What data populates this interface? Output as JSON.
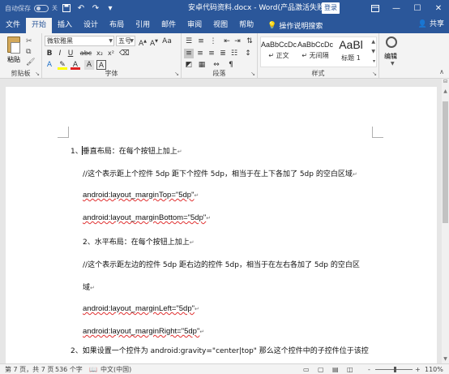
{
  "titlebar": {
    "autosave_label": "自动保存",
    "autosave_state": "关",
    "title": "安卓代码资料.docx  -  Word(产品激活失败)",
    "login": "登录",
    "icons": [
      "save-icon",
      "undo-icon",
      "redo-icon",
      "customize-icon"
    ],
    "ribbon_display_icon": "ribbon-display-icon",
    "minimize": "—",
    "restore": "☐",
    "close": "✕"
  },
  "tabs": {
    "items": [
      "文件",
      "开始",
      "插入",
      "设计",
      "布局",
      "引用",
      "邮件",
      "审阅",
      "视图",
      "帮助"
    ],
    "active": "开始",
    "tell_me": "操作说明搜索",
    "share": "共享"
  },
  "ribbon": {
    "clipboard": {
      "paste": "粘贴",
      "label": "剪贴板"
    },
    "font": {
      "name": "微软雅黑",
      "size": "五号",
      "label": "字体",
      "buttons": [
        "B",
        "I",
        "U",
        "abc",
        "x₂",
        "x²",
        "A",
        "A",
        "A",
        "Aa"
      ]
    },
    "paragraph": {
      "label": "段落"
    },
    "styles": {
      "label": "样式",
      "items": [
        {
          "sample": "AaBbCcDc",
          "name": "正文"
        },
        {
          "sample": "AaBbCcDc",
          "name": "无间隔"
        },
        {
          "sample": "AaBl",
          "name": "标题 1"
        }
      ]
    },
    "editing": {
      "label": "编辑"
    }
  },
  "document": {
    "lines": [
      "1、垂直布局：在每个按钮上加上",
      "//这个表示距上个控件 5dp 距下个控件 5dp，相当于在上下各加了 5dp 的空白区域",
      "android:layout_marginTop=\"5dp\"",
      "android:layout_marginBottom=\"5dp\"",
      "2、水平布局：在每个按钮上加上",
      "//这个表示距左边的控件 5dp 距右边的控件 5dp，相当于在左右各加了 5dp 的空白区",
      "域",
      "android:layout_marginLeft=\"5dp\"",
      "android:layout_marginRight=\"5dp\"",
      "2、如果设置一个控件为 android:gravity=\"center|top\" 那么这个控件中的子控件位于该控"
    ],
    "paragraph_mark": "↵"
  },
  "statusbar": {
    "page": "第 7 页，共 7 页",
    "words": "536 个字",
    "language": "中文(中国)",
    "zoom": "110%",
    "zoom_minus": "-",
    "zoom_plus": "+"
  }
}
